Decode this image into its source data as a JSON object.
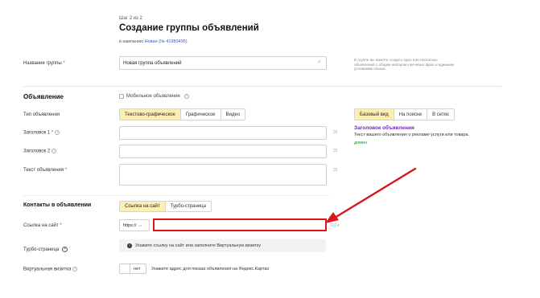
{
  "header": {
    "step": "Шаг 2 из 2",
    "title": "Создание группы объявлений",
    "campaign_prefix": "в кампанию",
    "campaign_link": "Новая (№ 41983495)"
  },
  "group": {
    "label": "Название группы",
    "value": "Новая группа объявлений",
    "hint": "В группе вы можете создать одно или несколько объявлений с общим набором ключевых фраз и едиными условиями показа."
  },
  "ad_section": {
    "title": "Объявление",
    "mobile_checkbox": "Мобильное объявление",
    "type_label": "Тип объявления",
    "types": [
      "Текстово-графическое",
      "Графическое",
      "Видео"
    ],
    "title1_label": "Заголовок 1",
    "title2_label": "Заголовок 2",
    "text_label": "Текст объявления",
    "counter": "35"
  },
  "preview": {
    "tabs": [
      "Базовый вид",
      "На поиске",
      "В сетях"
    ],
    "ad_title": "Заголовок объявления",
    "ad_text": "Текст вашего объявления о рекламе услуги или товара.",
    "domain": "домен"
  },
  "contacts": {
    "title": "Контакты в объявлении",
    "tabs": [
      "Ссылка на сайт",
      "Турбо-страница"
    ],
    "link_label": "Ссылка на сайт",
    "protocol": "https://",
    "counter": "1024",
    "turbo_label": "Турбо-страница",
    "turbo_notice": "Укажите ссылку на сайт или заполните Виртуальную визитку",
    "vcard_label": "Виртуальная визитка",
    "vcard_toggle": "нет",
    "vcard_text": "Укажите адрес для показа объявления на Яндекс.Картах"
  },
  "colors": {
    "highlight": "#d9171b",
    "active_tab": "#fdeeb4",
    "link": "#2a5bd7",
    "preview_title": "#6b2fb0",
    "domain": "#1b8a2e"
  }
}
